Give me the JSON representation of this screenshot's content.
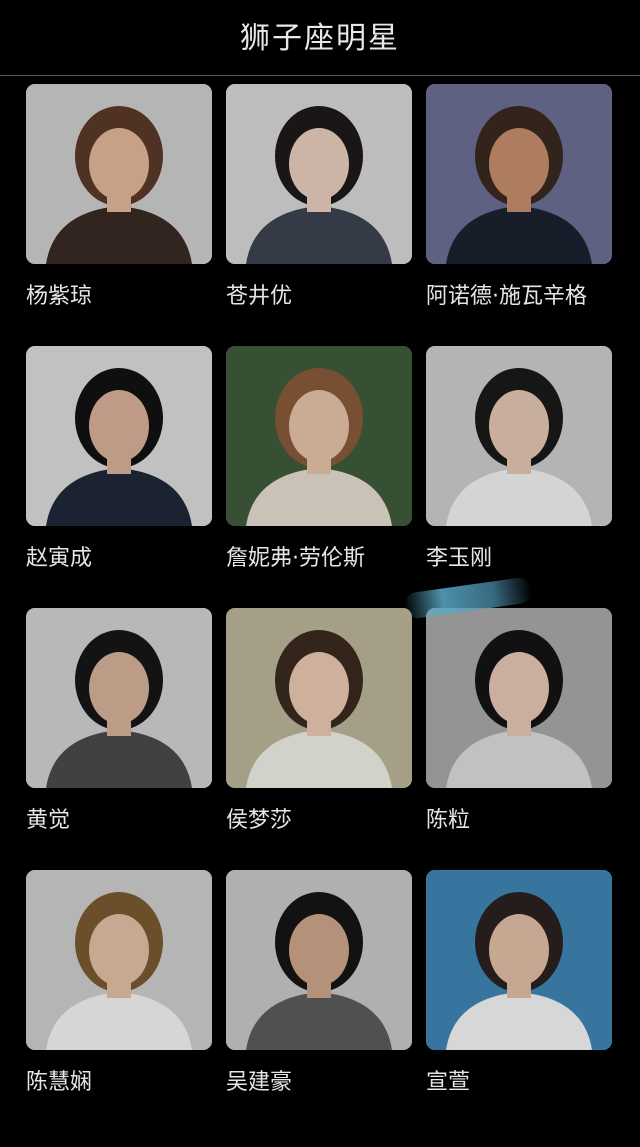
{
  "header": {
    "title": "狮子座明星"
  },
  "cards": [
    {
      "name": "杨紫琼",
      "bg": "#cfcfcf",
      "hair": "#5a3a28",
      "skin": "#e2b89a",
      "cloth": "#3a2b25"
    },
    {
      "name": "苍井优",
      "bg": "#d8d8d8",
      "hair": "#1e1a1a",
      "skin": "#e9cdbd",
      "cloth": "#3d4450"
    },
    {
      "name": "阿诺德·施瓦辛格",
      "bg": "#6b6f94",
      "hair": "#3a2a1e",
      "skin": "#c78e6c",
      "cloth": "#1c2130"
    },
    {
      "name": "赵寅成",
      "bg": "#dcdcdc",
      "hair": "#121212",
      "skin": "#d9b199",
      "cloth": "#1f2738"
    },
    {
      "name": "詹妮弗·劳伦斯",
      "bg": "#3f5a3a",
      "hair": "#8a5a3c",
      "skin": "#e6c3a8",
      "cloth": "#e6ddd0"
    },
    {
      "name": "李玉刚",
      "bg": "#cdcdcd",
      "hair": "#1a1a1a",
      "skin": "#e4c6b2",
      "cloth": "#f2f2f2"
    },
    {
      "name": "黄觉",
      "bg": "#d2d2d2",
      "hair": "#161616",
      "skin": "#d6b29a",
      "cloth": "#4a4a4a"
    },
    {
      "name": "侯梦莎",
      "bg": "#bdb59a",
      "hair": "#3b2a20",
      "skin": "#ecc9b3",
      "cloth": "#eef0e6"
    },
    {
      "name": "陈粒",
      "bg": "#a9a9a9",
      "hair": "#141414",
      "skin": "#e8c8b4",
      "cloth": "#dcdcdc"
    },
    {
      "name": "陈慧娴",
      "bg": "#cfcfcf",
      "hair": "#7a5a32",
      "skin": "#e3c0a6",
      "cloth": "#f4f4f4"
    },
    {
      "name": "吴建豪",
      "bg": "#c9c9c9",
      "hair": "#151515",
      "skin": "#cfa68a",
      "cloth": "#5c5c5c"
    },
    {
      "name": "宣萱",
      "bg": "#3f86b6",
      "hair": "#2a2220",
      "skin": "#e1bfa7",
      "cloth": "#f5f5f5"
    }
  ]
}
